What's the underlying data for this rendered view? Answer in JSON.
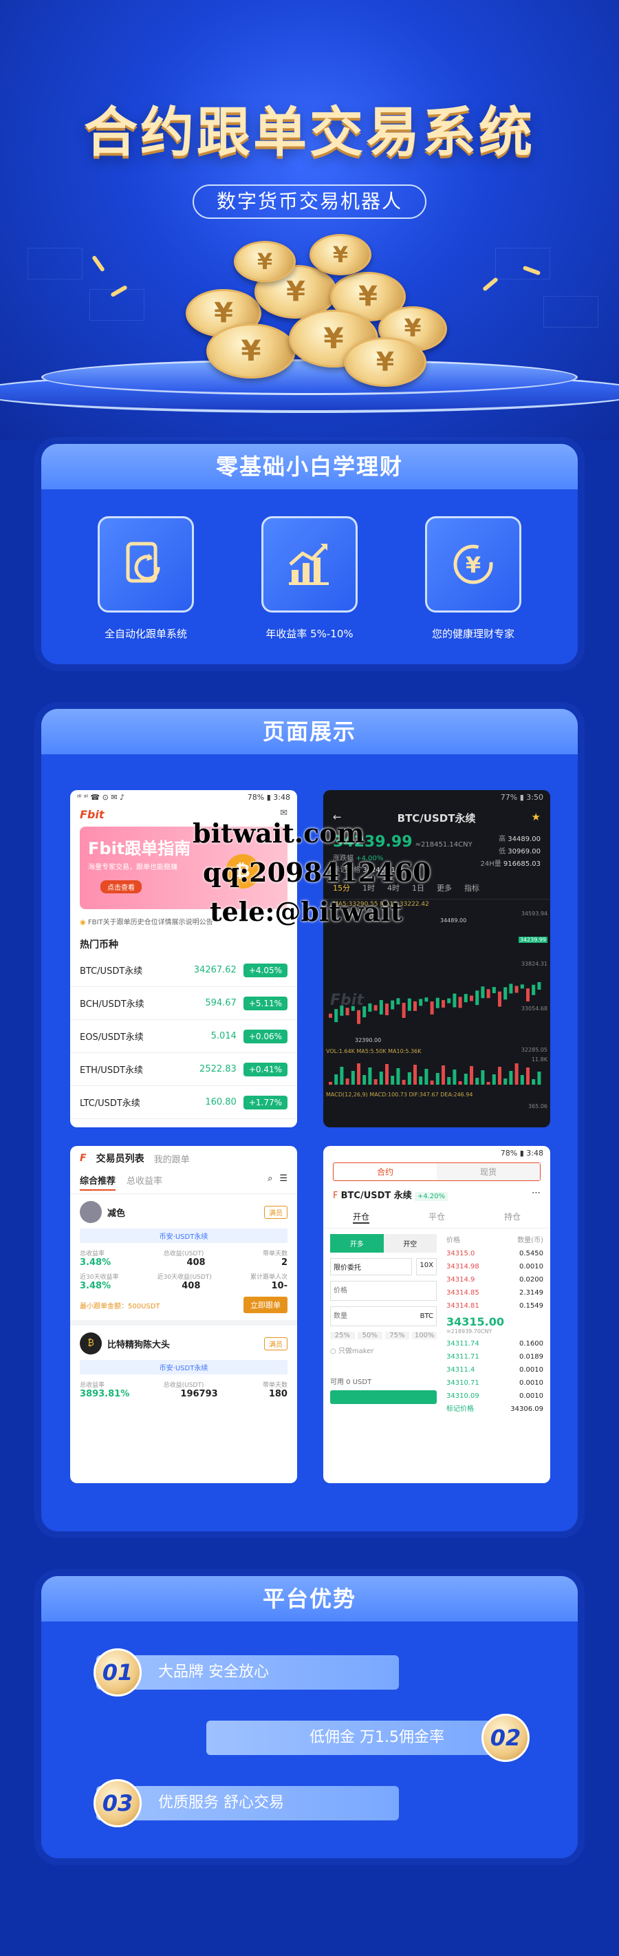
{
  "hero": {
    "title": "合约跟单交易系统",
    "subtitle": "数字货币交易机器人"
  },
  "section1": {
    "title": "零基础小白学理财",
    "features": [
      {
        "icon": "document-refresh-icon",
        "caption": "全自动化跟单系统"
      },
      {
        "icon": "bar-chart-growth-icon",
        "caption": "年收益率 5%-10%"
      },
      {
        "icon": "yen-cycle-icon",
        "caption": "您的健康理财专家"
      }
    ]
  },
  "section2": {
    "title": "页面展示",
    "phone1": {
      "status_left": "ᵈˡ ᵃˡ ☎ ⊙ ✉ ♪",
      "status_right": "78% ▮ 3:48",
      "logo": "Fbit",
      "banner_title": "Fbit跟单指南",
      "banner_sub": "海量专家交易，跟单也能稳赚",
      "banner_btn": "点击查看",
      "notice": "FBIT关于跟单历史仓位详情展示说明公告",
      "hot_label": "热门币种",
      "rows": [
        {
          "name": "BTC/USDT永续",
          "price": "34267.62",
          "change": "+4.05%"
        },
        {
          "name": "BCH/USDT永续",
          "price": "594.67",
          "change": "+5.11%"
        },
        {
          "name": "EOS/USDT永续",
          "price": "5.014",
          "change": "+0.06%"
        },
        {
          "name": "ETH/USDT永续",
          "price": "2522.83",
          "change": "+0.41%"
        },
        {
          "name": "LTC/USDT永续",
          "price": "160.80",
          "change": "+1.77%"
        }
      ]
    },
    "phone2": {
      "status_right": "77% ▮ 3:50",
      "title": "BTC/USDT永续",
      "price": "34239.99",
      "cny": "≈218451.14CNY",
      "change_label": "涨跌幅",
      "change": "+4.00%",
      "mark_label": "标记价格",
      "mark": "34241.61",
      "high_label": "高",
      "high": "34489.00",
      "low_label": "低",
      "low": "30969.00",
      "vol_label": "24H量",
      "vol": "916685.03",
      "tabs": [
        "15分",
        "1时",
        "4时",
        "1日",
        "更多",
        "指标"
      ],
      "ma_line": "MA5:33290.55  MA10:33222.42",
      "axis": [
        "34593.94",
        "34239.99",
        "33824.31",
        "33054.68",
        "32285.05",
        "11.8K",
        "365.06"
      ],
      "vol_line": "VOL:1.64K  MA5:5.50K  MA10:5.36K",
      "macd_line": "MACD(12,26,9)  MACD:100.73  DIF:347.67  DEA:246.94",
      "hi_mark": "34489.00",
      "lo_mark": "32390.00"
    },
    "phone3": {
      "logo": "交易员列表",
      "tab2": "我的跟单",
      "filter1": "综合推荐",
      "filter2": "总收益率",
      "trader1": {
        "name": "减色",
        "tag": "满员",
        "market": "币安·USDT永续",
        "l1": "总收益率",
        "l2": "总收益(USDT)",
        "l3": "带单天数",
        "v1": "3.48%",
        "v2": "408",
        "v3": "2",
        "l4": "近30天收益率",
        "l5": "近30天收益(USDT)",
        "l6": "累计跟单人次",
        "v4": "3.48%",
        "v5": "408",
        "v6": "10-",
        "min": "最小跟单金额：500USDT",
        "btn": "立即跟单"
      },
      "trader2": {
        "name": "比特精狗陈大头",
        "tag": "满员",
        "market": "币安·USDT永续",
        "l1": "总收益率",
        "l2": "总收益(USDT)",
        "l3": "带单天数",
        "v1": "3893.81%",
        "v2": "196793",
        "v3": "180"
      }
    },
    "phone4": {
      "status_right": "78% ▮ 3:48",
      "tab1": "合约",
      "tab2": "现货",
      "pair": "BTC/USDT 永续",
      "pair_change": "+4.20%",
      "open": "开仓",
      "hold": "平仓",
      "pos": "持仓",
      "buy": "开多",
      "sell": "开空",
      "order_type": "限价委托",
      "lever": "10X",
      "price_ph": "价格",
      "qty_ph": "数量",
      "unit": "BTC",
      "pcts": [
        "25%",
        "50%",
        "75%",
        "100%"
      ],
      "maker": "只做maker",
      "avail": "可用 0 USDT",
      "book_head1": "价格",
      "book_head2": "数量(币)",
      "asks": [
        [
          "34315.0",
          "0.5450"
        ],
        [
          "34314.98",
          "0.0010"
        ],
        [
          "34314.9",
          "0.0200"
        ],
        [
          "34314.85",
          "2.3149"
        ],
        [
          "34314.81",
          "0.1549"
        ]
      ],
      "last": "34315.00",
      "last_cny": "≈218939.70CNY",
      "bids": [
        [
          "34311.74",
          "0.1600"
        ],
        [
          "34311.71",
          "0.0189"
        ],
        [
          "34311.4",
          "0.0010"
        ],
        [
          "34310.71",
          "0.0010"
        ],
        [
          "34310.09",
          "0.0010"
        ],
        [
          "标记价格",
          "34306.09"
        ]
      ]
    }
  },
  "section3": {
    "title": "平台优势",
    "items": [
      {
        "num": "01",
        "text": "大品牌  安全放心"
      },
      {
        "num": "02",
        "text": "低佣金  万1.5佣金率"
      },
      {
        "num": "03",
        "text": "优质服务  舒心交易"
      }
    ]
  },
  "watermark": {
    "l1": "bitwait.com",
    "l2": "qq:2098412460",
    "l3": "tele:@bitwait"
  }
}
